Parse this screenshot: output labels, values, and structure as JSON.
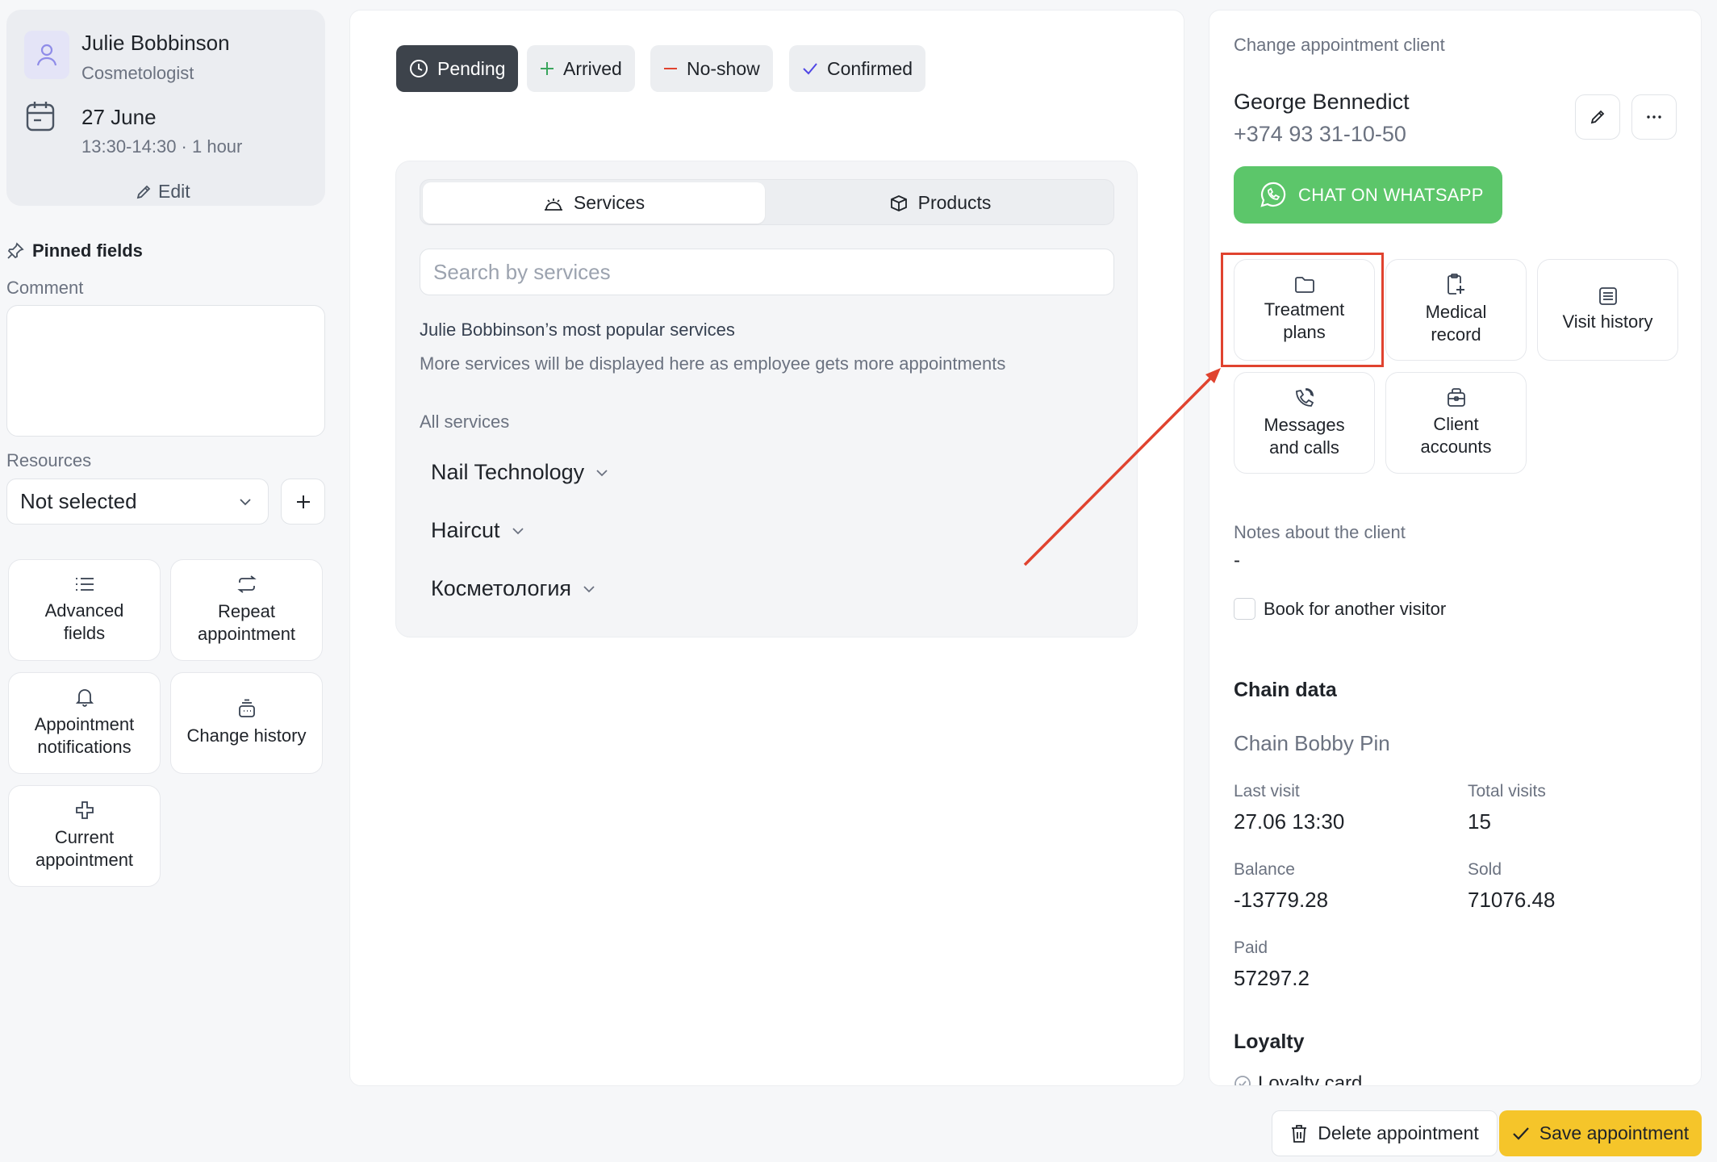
{
  "employee": {
    "name": "Julie Bobbinson",
    "role": "Cosmetologist",
    "date": "27 June",
    "time": "13:30-14:30 · 1 hour",
    "edit_label": "Edit"
  },
  "pinned": {
    "title": "Pinned fields",
    "comment_label": "Comment",
    "resources_label": "Resources",
    "resources_value": "Not selected"
  },
  "left_tiles": [
    {
      "label": "Advanced fields",
      "icon": "list-icon"
    },
    {
      "label": "Repeat appointment",
      "icon": "repeat-icon"
    },
    {
      "label": "Appointment notifications",
      "icon": "bell-icon"
    },
    {
      "label": "Change history",
      "icon": "history-icon"
    },
    {
      "label": "Current appointment",
      "icon": "cross-icon"
    }
  ],
  "statuses": [
    {
      "label": "Pending",
      "icon": "clock-icon",
      "active": true
    },
    {
      "label": "Arrived",
      "icon": "plus-icon",
      "color": "#3aa55d"
    },
    {
      "label": "No-show",
      "icon": "minus-icon",
      "color": "#e0432f"
    },
    {
      "label": "Confirmed",
      "icon": "check-icon",
      "color": "#4f46e5"
    }
  ],
  "tabs": {
    "services": "Services",
    "products": "Products"
  },
  "search": {
    "placeholder": "Search by services"
  },
  "services": {
    "popular_title": "Julie Bobbinson’s most popular services",
    "popular_sub": "More services will be displayed here as employee gets more appointments",
    "all_label": "All services",
    "categories": [
      "Nail Technology",
      "Haircut",
      "Косметология"
    ]
  },
  "client": {
    "change_label": "Change appointment client",
    "name": "George Bennedict",
    "phone": "+374 93 31-10-50",
    "whatsapp_label": "CHAT ON WHATSAPP",
    "tiles": [
      {
        "label": "Treatment plans",
        "icon": "folder-icon"
      },
      {
        "label": "Medical record",
        "icon": "medical-record-icon"
      },
      {
        "label": "Visit history",
        "icon": "visit-history-icon"
      },
      {
        "label": "Messages and calls",
        "icon": "phone-message-icon"
      },
      {
        "label": "Client accounts",
        "icon": "wallet-icon"
      }
    ],
    "notes_label": "Notes about the client",
    "notes_value": "-",
    "book_other_label": "Book for another visitor"
  },
  "chain": {
    "title": "Chain data",
    "name": "Chain Bobby Pin",
    "last_visit_label": "Last visit",
    "last_visit": "27.06 13:30",
    "total_visits_label": "Total visits",
    "total_visits": "15",
    "balance_label": "Balance",
    "balance": "-13779.28",
    "sold_label": "Sold",
    "sold": "71076.48",
    "paid_label": "Paid",
    "paid": "57297.2"
  },
  "loyalty": {
    "title": "Loyalty",
    "card_label": "Loyalty card"
  },
  "footer": {
    "delete_label": "Delete appointment",
    "save_label": "Save appointment"
  },
  "colors": {
    "whatsapp": "#5cc66a",
    "save": "#f5c52a",
    "annotation": "#e0432f"
  }
}
